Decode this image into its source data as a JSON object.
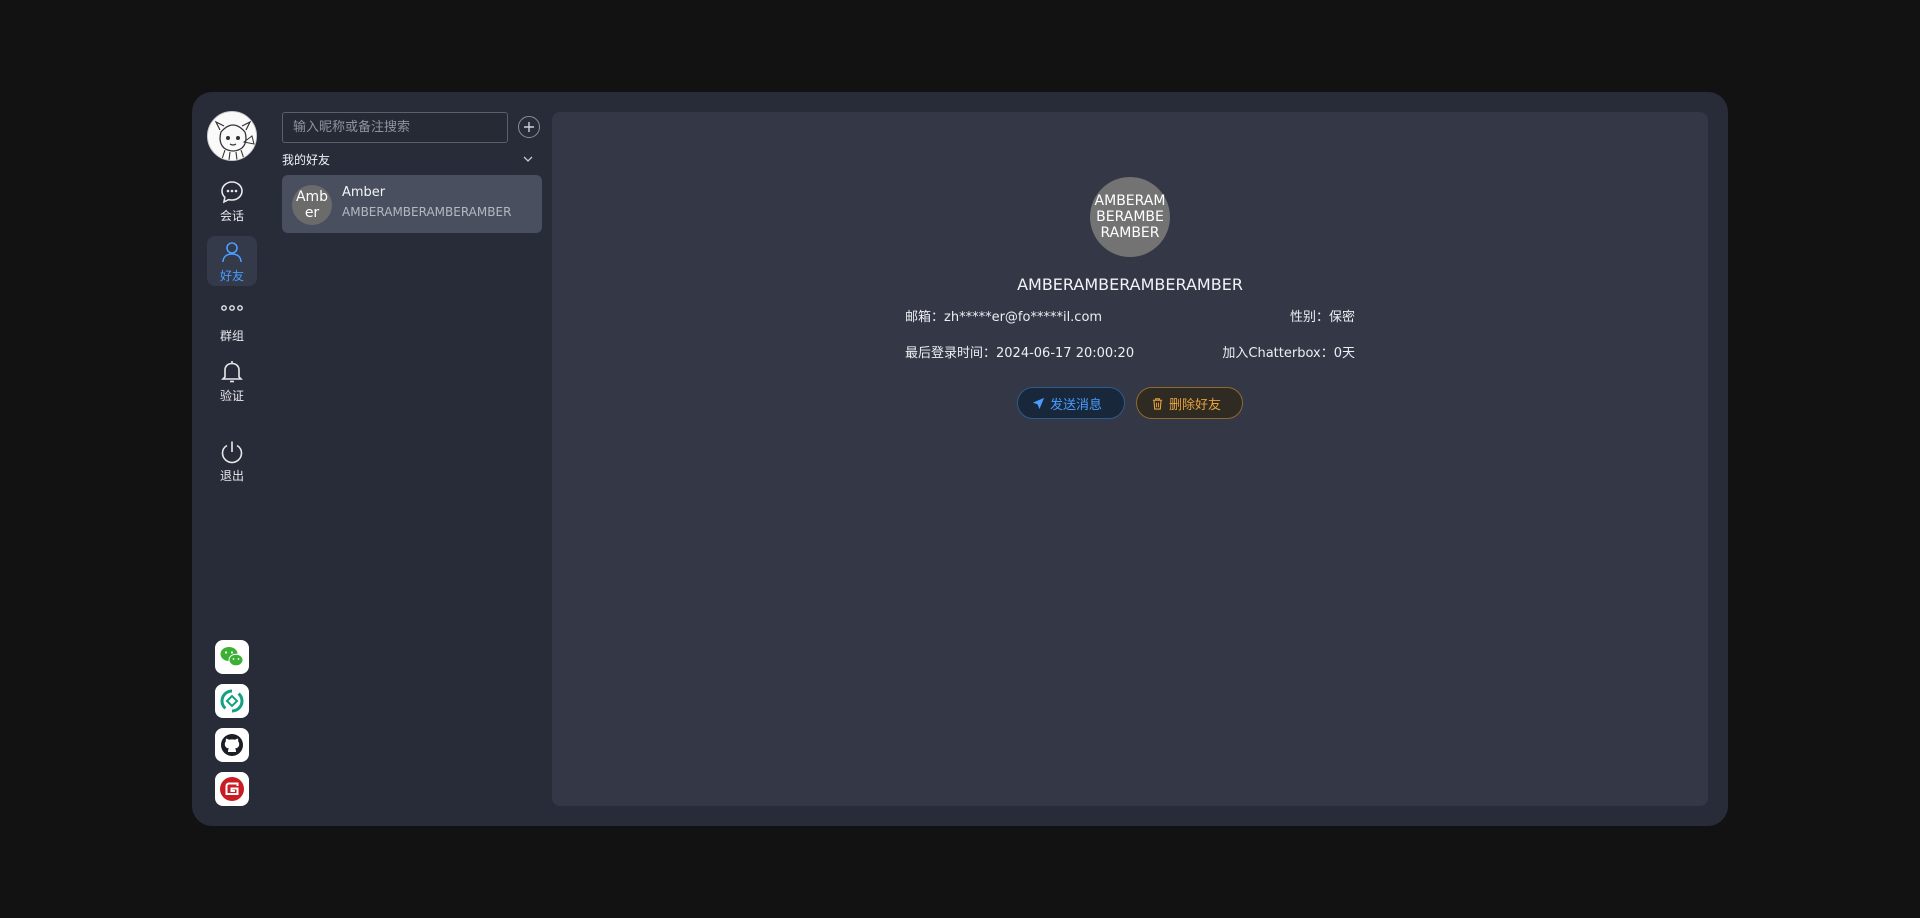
{
  "nav": {
    "items": [
      {
        "label": "会话",
        "icon": "chat-bubble-icon"
      },
      {
        "label": "好友",
        "icon": "user-icon"
      },
      {
        "label": "群组",
        "icon": "group-dots-icon"
      },
      {
        "label": "验证",
        "icon": "bell-icon"
      }
    ],
    "logout_label": "退出",
    "active": "好友",
    "active_color": "#4a9cff"
  },
  "external_links": [
    {
      "icon": "wechat-icon"
    },
    {
      "icon": "green-loop-icon"
    },
    {
      "icon": "github-icon"
    },
    {
      "icon": "gitee-icon"
    }
  ],
  "friends": {
    "search_placeholder": "输入昵称或备注搜索",
    "group_title": "我的好友",
    "items": [
      {
        "avatar_text": "Amber",
        "name": "Amber",
        "subtitle": "AMBERAMBERAMBERAMBER"
      }
    ]
  },
  "profile": {
    "avatar_text": "AMBERAMBERAMBERAMBER",
    "nickname": "AMBERAMBERAMBERAMBER",
    "email_label": "邮箱：",
    "email": "zh*****er@fo*****il.com",
    "gender_label": "性别：",
    "gender": "保密",
    "last_login_label": "最后登录时间：",
    "last_login": "2024-06-17 20:00:20",
    "joined_label": "加入Chatterbox：",
    "joined": "0天",
    "send_button": "发送消息",
    "delete_button": "删除好友"
  }
}
